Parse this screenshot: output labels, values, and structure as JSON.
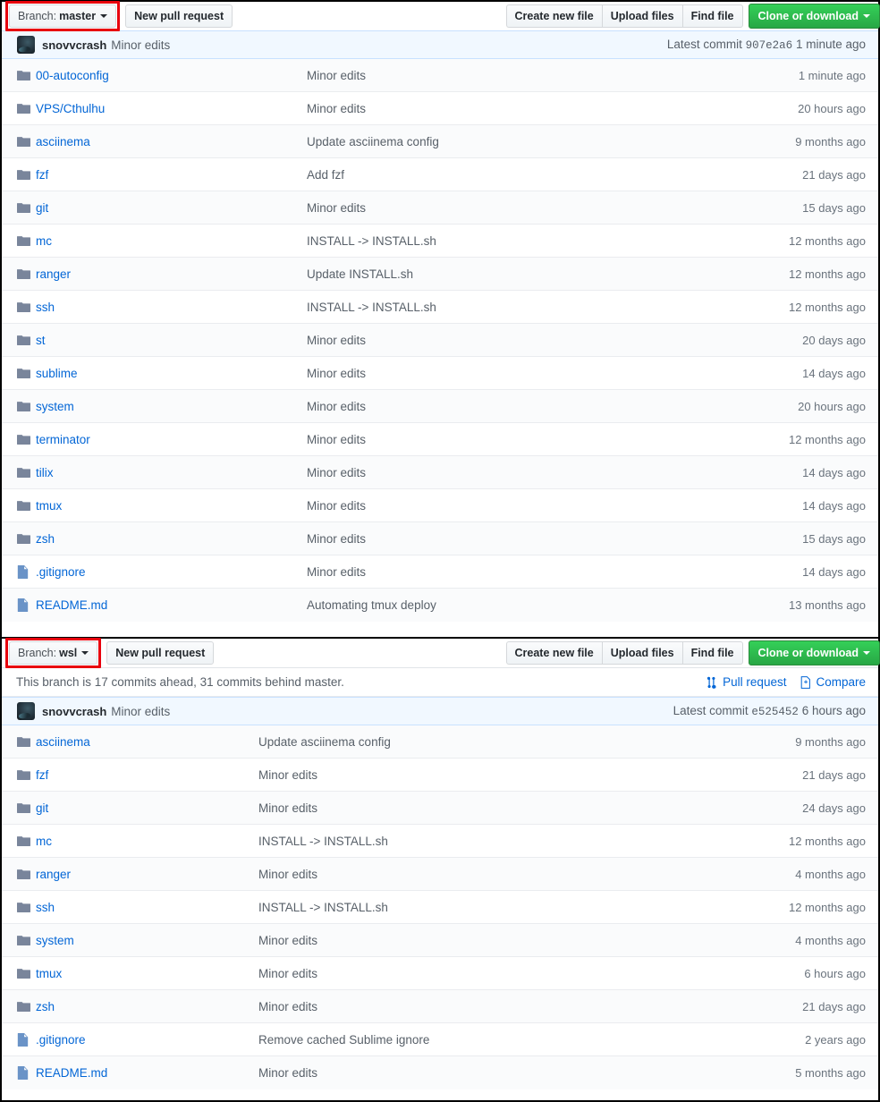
{
  "panels": [
    {
      "id": "master",
      "toolbar": {
        "branch_prefix": "Branch:",
        "branch_name": "master",
        "new_pull_request": "New pull request",
        "create_new_file": "Create new file",
        "upload_files": "Upload files",
        "find_file": "Find file",
        "clone_or_download": "Clone or download",
        "branch_highlight_color": "#e8000d",
        "clone_button_color": "#28a745"
      },
      "branch_status": null,
      "commit": {
        "author": "snovvcrash",
        "message": "Minor edits",
        "latest_commit_label": "Latest commit",
        "sha": "907e2a6",
        "time": "1 minute ago"
      },
      "files": [
        {
          "icon": "folder-icon",
          "name": "00-autoconfig",
          "message": "Minor edits",
          "time": "1 minute ago"
        },
        {
          "icon": "folder-icon",
          "name": "VPS/Cthulhu",
          "message": "Minor edits",
          "time": "20 hours ago"
        },
        {
          "icon": "folder-icon",
          "name": "asciinema",
          "message": "Update asciinema config",
          "time": "9 months ago"
        },
        {
          "icon": "folder-icon",
          "name": "fzf",
          "message": "Add fzf",
          "time": "21 days ago"
        },
        {
          "icon": "folder-icon",
          "name": "git",
          "message": "Minor edits",
          "time": "15 days ago"
        },
        {
          "icon": "folder-icon",
          "name": "mc",
          "message": "INSTALL -> INSTALL.sh",
          "time": "12 months ago"
        },
        {
          "icon": "folder-icon",
          "name": "ranger",
          "message": "Update INSTALL.sh",
          "time": "12 months ago"
        },
        {
          "icon": "folder-icon",
          "name": "ssh",
          "message": "INSTALL -> INSTALL.sh",
          "time": "12 months ago"
        },
        {
          "icon": "folder-icon",
          "name": "st",
          "message": "Minor edits",
          "time": "20 days ago"
        },
        {
          "icon": "folder-icon",
          "name": "sublime",
          "message": "Minor edits",
          "time": "14 days ago"
        },
        {
          "icon": "folder-icon",
          "name": "system",
          "message": "Minor edits",
          "time": "20 hours ago"
        },
        {
          "icon": "folder-icon",
          "name": "terminator",
          "message": "Minor edits",
          "time": "12 months ago"
        },
        {
          "icon": "folder-icon",
          "name": "tilix",
          "message": "Minor edits",
          "time": "14 days ago"
        },
        {
          "icon": "folder-icon",
          "name": "tmux",
          "message": "Minor edits",
          "time": "14 days ago"
        },
        {
          "icon": "folder-icon",
          "name": "zsh",
          "message": "Minor edits",
          "time": "15 days ago"
        },
        {
          "icon": "file-icon",
          "name": ".gitignore",
          "message": "Minor edits",
          "time": "14 days ago"
        },
        {
          "icon": "file-icon",
          "name": "README.md",
          "message": "Automating tmux deploy",
          "time": "13 months ago"
        }
      ]
    },
    {
      "id": "wsl",
      "toolbar": {
        "branch_prefix": "Branch:",
        "branch_name": "wsl",
        "new_pull_request": "New pull request",
        "create_new_file": "Create new file",
        "upload_files": "Upload files",
        "find_file": "Find file",
        "clone_or_download": "Clone or download",
        "branch_highlight_color": "#e8000d",
        "clone_button_color": "#28a745"
      },
      "branch_status": {
        "text": "This branch is 17 commits ahead, 31 commits behind master.",
        "pull_request": "Pull request",
        "compare": "Compare"
      },
      "commit": {
        "author": "snovvcrash",
        "message": "Minor edits",
        "latest_commit_label": "Latest commit",
        "sha": "e525452",
        "time": "6 hours ago"
      },
      "files": [
        {
          "icon": "folder-icon",
          "name": "asciinema",
          "message": "Update asciinema config",
          "time": "9 months ago"
        },
        {
          "icon": "folder-icon",
          "name": "fzf",
          "message": "Minor edits",
          "time": "21 days ago"
        },
        {
          "icon": "folder-icon",
          "name": "git",
          "message": "Minor edits",
          "time": "24 days ago"
        },
        {
          "icon": "folder-icon",
          "name": "mc",
          "message": "INSTALL -> INSTALL.sh",
          "time": "12 months ago"
        },
        {
          "icon": "folder-icon",
          "name": "ranger",
          "message": "Minor edits",
          "time": "4 months ago"
        },
        {
          "icon": "folder-icon",
          "name": "ssh",
          "message": "INSTALL -> INSTALL.sh",
          "time": "12 months ago"
        },
        {
          "icon": "folder-icon",
          "name": "system",
          "message": "Minor edits",
          "time": "4 months ago"
        },
        {
          "icon": "folder-icon",
          "name": "tmux",
          "message": "Minor edits",
          "time": "6 hours ago"
        },
        {
          "icon": "folder-icon",
          "name": "zsh",
          "message": "Minor edits",
          "time": "21 days ago"
        },
        {
          "icon": "file-icon",
          "name": ".gitignore",
          "message": "Remove cached Sublime ignore",
          "time": "2 years ago"
        },
        {
          "icon": "file-icon",
          "name": "README.md",
          "message": "Minor edits",
          "time": "5 months ago"
        }
      ]
    }
  ]
}
